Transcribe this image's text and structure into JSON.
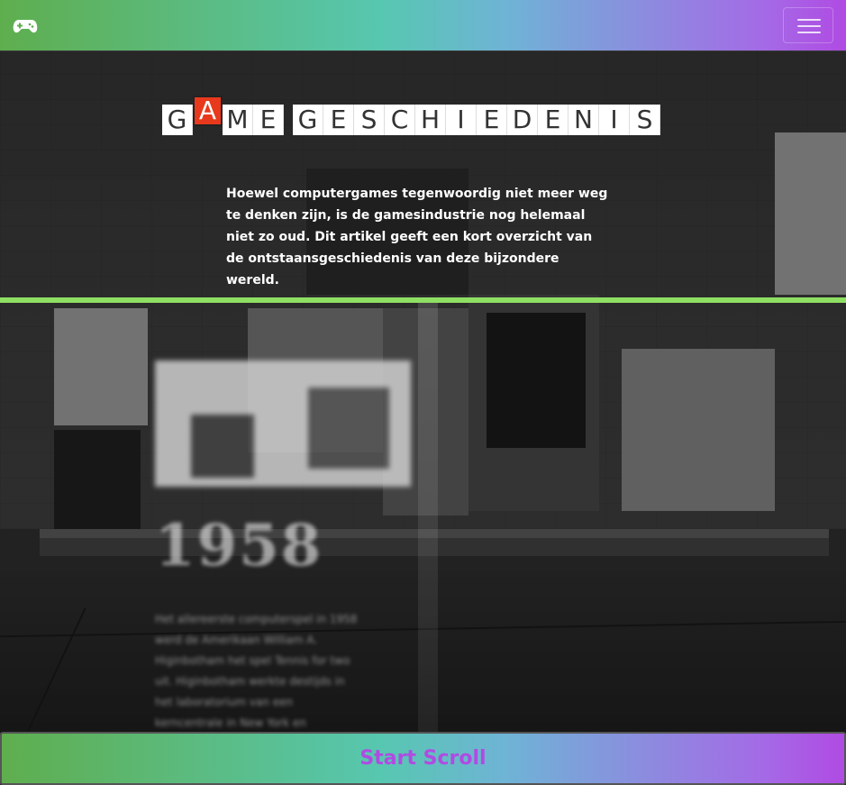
{
  "navbar": {
    "logo_icon": "gamepad-icon",
    "menu_icon": "hamburger-menu-icon"
  },
  "hero": {
    "title_letters": [
      "G",
      "A",
      "M",
      "E",
      " ",
      "G",
      "E",
      "S",
      "C",
      "H",
      "I",
      "E",
      "D",
      "E",
      "N",
      "I",
      "S"
    ],
    "highlighted_letter": "A",
    "intro": "Hoewel computergames tegenwoordig niet meer weg te denken zijn, is de gamesindustrie nog helemaal niet zo oud. Dit artikel geeft een kort overzicht van de ontstaansgeschiedenis van deze bijzondere wereld."
  },
  "timeline": {
    "year": "1958",
    "text": "Het allereerste computerspel in 1958 werd de Amerikaan William A. Higinbotham het spel Tennis for two uit. Higinbotham werkte destijds in het laboratorium van een kerncentrale in New York en"
  },
  "footer": {
    "start_label": "Start Scroll"
  },
  "colors": {
    "accent_green": "#8ee063",
    "accent_purple": "#b04be3",
    "title_highlight": "#e8391c"
  }
}
